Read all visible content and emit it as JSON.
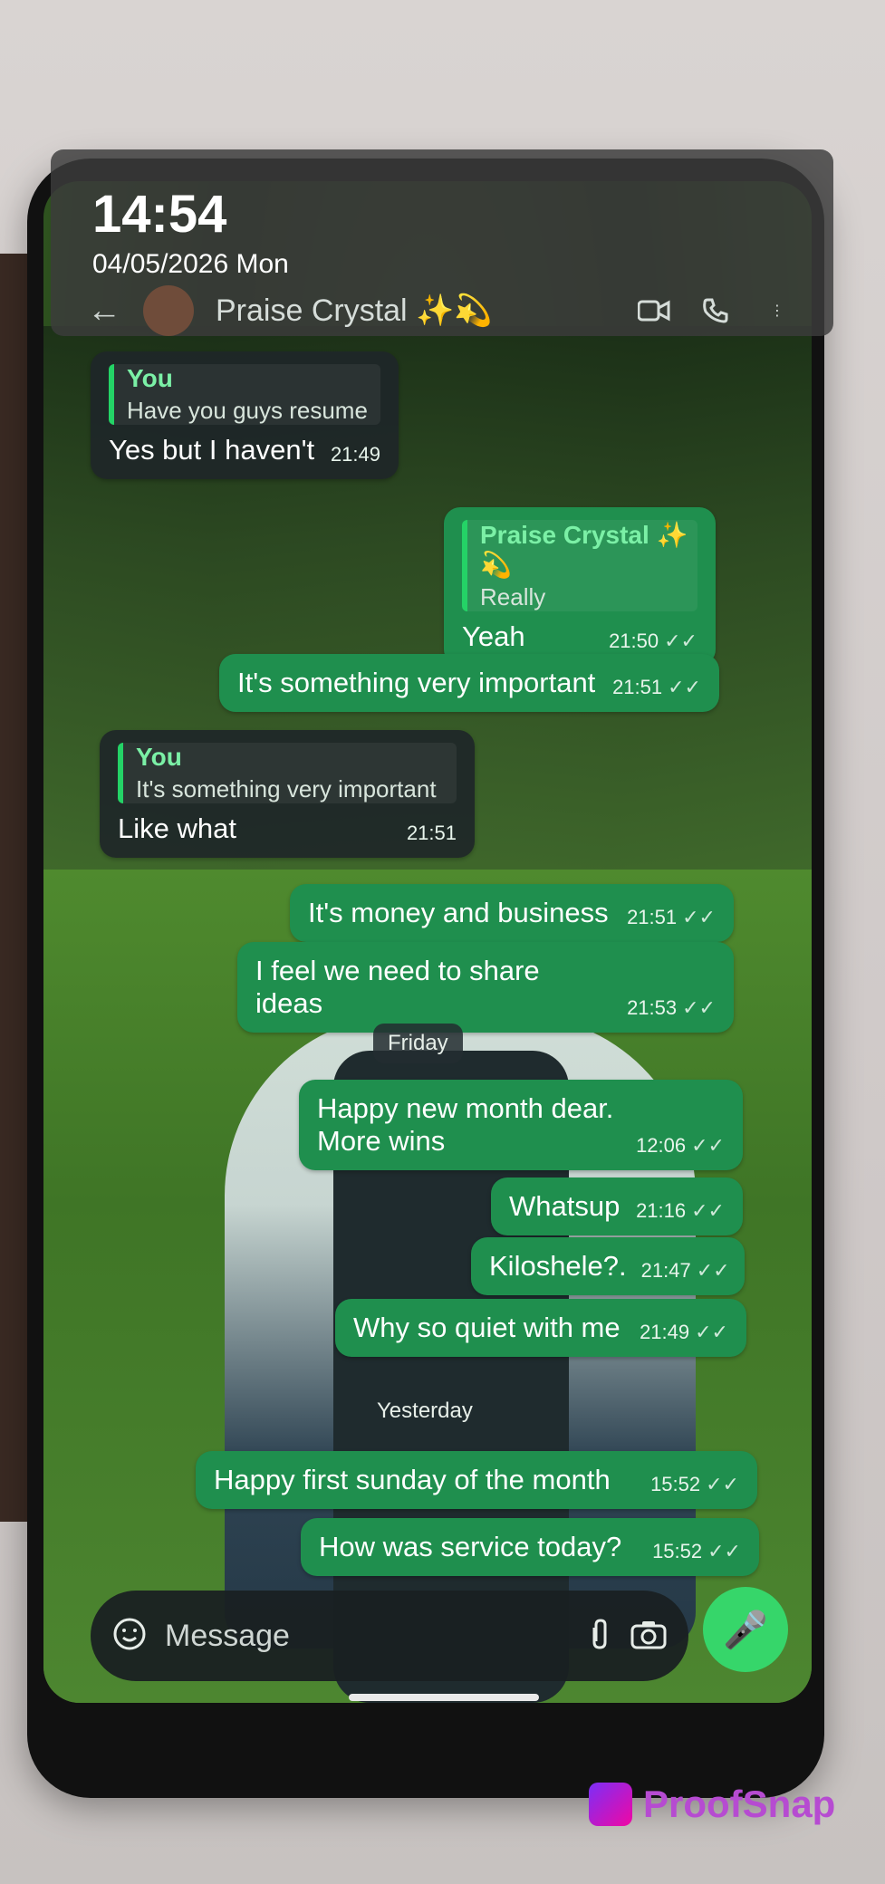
{
  "status": {
    "time": "14:54",
    "date": "04/05/2026 Mon"
  },
  "chat_header": {
    "name": "Praise Crystal ✨💫",
    "icons": [
      "back-arrow-icon",
      "avatar",
      "video-call-icon",
      "voice-call-icon",
      "more-vert-icon"
    ]
  },
  "messages": [
    {
      "dir": "in",
      "quote_name": "You",
      "quote_text": "Have you guys resume",
      "text": "Yes but I haven't",
      "time": "21:49"
    },
    {
      "dir": "out",
      "quote_name": "Praise Crystal ✨💫",
      "quote_text": "Really",
      "text": "Yeah",
      "time": "21:50"
    },
    {
      "dir": "out",
      "text": "It's something very important",
      "time": "21:51"
    },
    {
      "dir": "in",
      "quote_name": "You",
      "quote_text": "It's something very important",
      "text": "Like what",
      "time": "21:51"
    },
    {
      "dir": "out",
      "text": "It's money and business",
      "time": "21:51"
    },
    {
      "dir": "out",
      "text": "I feel we need to share ideas",
      "time": "21:53"
    },
    {
      "dir": "out",
      "text": "Happy new month dear.\nMore wins",
      "time": "12:06"
    },
    {
      "dir": "out",
      "text": "Whatsup",
      "time": "21:16"
    },
    {
      "dir": "out",
      "text": "Kiloshele?.",
      "time": "21:47"
    },
    {
      "dir": "out",
      "text": "Why so quiet with me",
      "time": "21:49"
    },
    {
      "dir": "out",
      "text": "Happy first sunday of the month",
      "time": "15:52"
    },
    {
      "dir": "out",
      "text": "How was service today?",
      "time": "15:52"
    }
  ],
  "day_separators": {
    "friday": "Friday",
    "yesterday": "Yesterday"
  },
  "composer": {
    "placeholder": "Message"
  },
  "brand": {
    "name": "ProofSnap"
  },
  "colors": {
    "outgoing_bubble": "#1f8f4e",
    "incoming_bubble": "#1e2628",
    "accent": "#24d366",
    "mic_button": "#36d66a",
    "brand": "#b64bd1"
  }
}
